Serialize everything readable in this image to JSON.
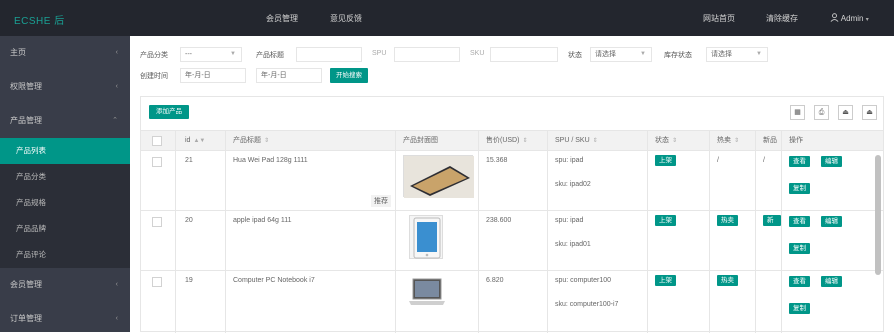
{
  "topbar": {
    "logo": "ECSHE 后",
    "nav": [
      "会员管理",
      "意见反馈"
    ],
    "right": [
      "网站首页",
      "清除缓存",
      "Admin"
    ]
  },
  "sidebar": {
    "items": [
      {
        "label": "主页",
        "chev": "‹"
      },
      {
        "label": "权限管理",
        "chev": "‹"
      },
      {
        "label": "产品管理",
        "chev": "⌃"
      }
    ],
    "sub": [
      "产品列表",
      "产品分类",
      "产品规格",
      "产品品牌",
      "产品评论"
    ],
    "items_after": [
      {
        "label": "会员管理",
        "chev": "‹"
      },
      {
        "label": "订单管理",
        "chev": "‹"
      }
    ]
  },
  "filters": {
    "category_label": "产品分类",
    "category_value": "---",
    "title_label": "产品标题",
    "spu_label": "SPU",
    "sku_label": "SKU",
    "status_label": "状态",
    "status_value": "请选择",
    "stock_label": "库存状态",
    "stock_value": "请选择",
    "created_label": "创建时间",
    "date_from": "年-月-日",
    "date_to": "年-月-日",
    "search_btn": "开始搜索"
  },
  "toolbar": {
    "add_btn": "添加产品",
    "icons": [
      "▦",
      "⎙",
      "⏏",
      "⏏"
    ]
  },
  "table": {
    "headers": [
      "id",
      "产品标题",
      "产品封面图",
      "售价(USD)",
      "SPU / SKU",
      "状态",
      "热卖",
      "新品",
      "操作"
    ],
    "rows": [
      {
        "id": "21",
        "title": "Hua Wei Pad 128g 1111",
        "badge": "推荐",
        "price": "15.368",
        "spu": "spu: ipad",
        "sku": "sku: ipad02",
        "status": "上架",
        "hot": "/",
        "new": "/",
        "actions": [
          "查看",
          "编辑",
          "复制"
        ]
      },
      {
        "id": "20",
        "title": "apple ipad 64g 111",
        "badge": "",
        "price": "238.600",
        "spu": "spu: ipad",
        "sku": "sku: ipad01",
        "status": "上架",
        "hot": "热卖",
        "new": "新品",
        "actions": [
          "查看",
          "编辑",
          "复制"
        ]
      },
      {
        "id": "19",
        "title": "Computer PC Notebook i7",
        "badge": "",
        "price": "6.820",
        "spu": "spu: computer100",
        "sku": "sku: computer100-i7",
        "status": "上架",
        "hot": "热卖",
        "new": "",
        "actions": [
          "查看",
          "编辑",
          "复制"
        ]
      }
    ]
  }
}
